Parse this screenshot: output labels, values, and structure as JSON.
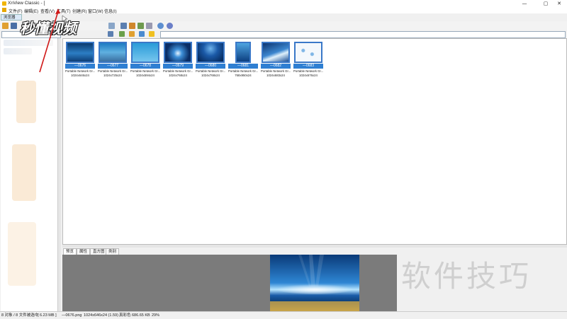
{
  "window": {
    "title": "XnView Classic - [",
    "controls": {
      "minimize": "—",
      "maximize": "▢",
      "close": "✕"
    }
  },
  "menu": [
    "文件(F)",
    "编辑(E)",
    "查看(V)",
    "工具(T)",
    "创建(R)",
    "窗口(W)",
    "信息(I)"
  ],
  "tabs": {
    "browser": "浏览器"
  },
  "thumbnails": [
    {
      "name": "—0676",
      "type": "Portable Network Gr...",
      "dims": "1024x646x24",
      "img": "ocean-light"
    },
    {
      "name": "—0677",
      "type": "Portable Network Gr...",
      "dims": "1024x725x24",
      "img": "coral-reef"
    },
    {
      "name": "—0678",
      "type": "Portable Network Gr...",
      "dims": "1024x594x24",
      "img": "underwater"
    },
    {
      "name": "—0679",
      "type": "Portable Network Gr...",
      "dims": "1024x768x24",
      "img": "light-ray"
    },
    {
      "name": "—0680",
      "type": "Portable Network Gr...",
      "dims": "1024x768x24",
      "img": "deep-blue"
    },
    {
      "name": "—0681",
      "type": "Portable Network Gr...",
      "dims": "768x950x24",
      "img": "vertical-blue"
    },
    {
      "name": "—0682",
      "type": "Portable Network Gr...",
      "dims": "1024x683x24",
      "img": "blue-wave"
    },
    {
      "name": "—0683",
      "type": "Portable Network Gr...",
      "dims": "1024x676x24",
      "img": "bubbles"
    }
  ],
  "preview_tabs": [
    "预览",
    "属性",
    "直方图",
    "类别"
  ],
  "status": {
    "objects": "8 对象 / 8 文件被选中",
    "size": "[ 6.23 MB ]",
    "filename": "—0676.png",
    "dims": "1024x646x24 (1.59)",
    "color": "真彩色",
    "filesize": "686.65 KB",
    "zoom": "29%"
  },
  "watermark": {
    "logo": "秒懂视频",
    "text": "软件技巧"
  },
  "colors": {
    "selection": "#2f7fd2",
    "preview_bg": "#7b7b7b"
  }
}
